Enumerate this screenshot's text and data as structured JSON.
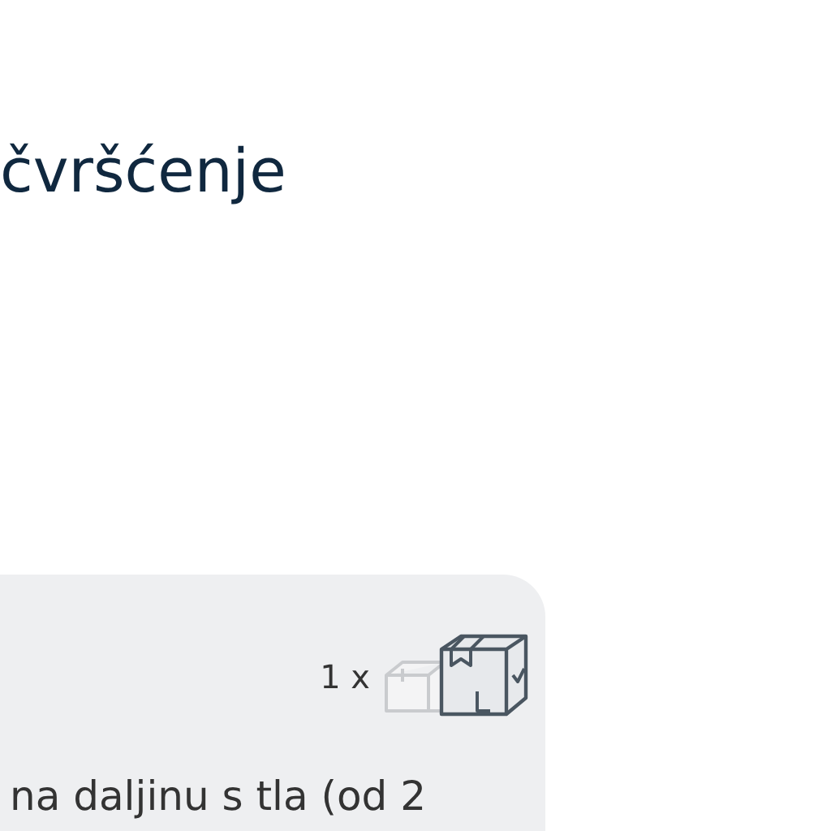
{
  "heading": "čvršćenje",
  "card": {
    "quantity": "1 x",
    "description": "na daljinu s tla (od 2"
  }
}
